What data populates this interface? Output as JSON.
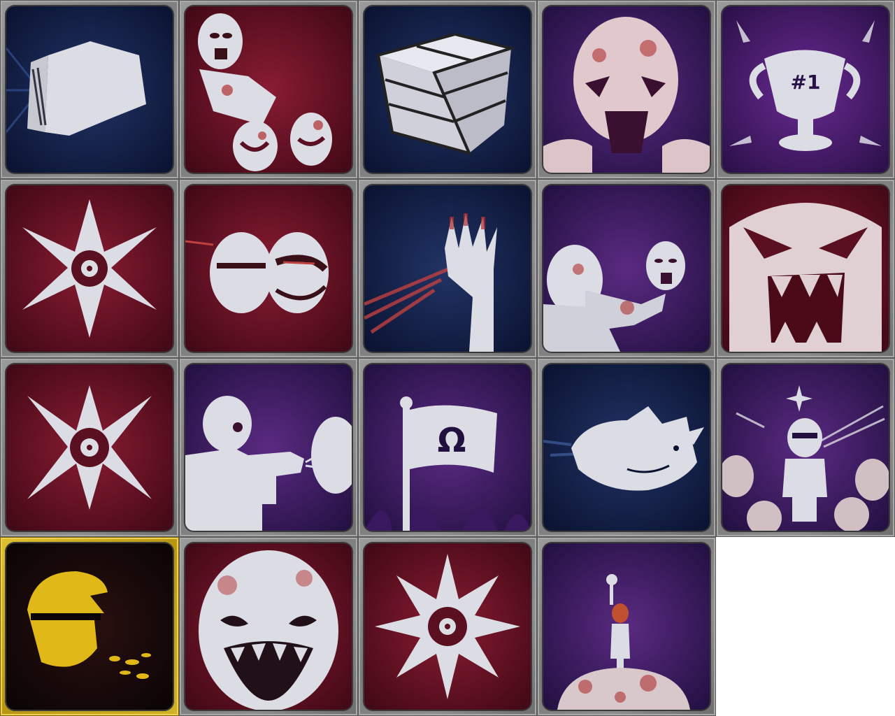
{
  "colors": {
    "frame": "#8a8a8a",
    "frame_gold": "#d4b020",
    "bg_blue": "#14204a",
    "bg_red": "#6a1024",
    "bg_purple": "#3c1858",
    "bg_black": "#120808",
    "figure": "#dcdce4",
    "blood": "#b03030",
    "gold_figure": "#e0b818"
  },
  "icons": [
    {
      "name": "punch-fist-icon",
      "bg": "blue"
    },
    {
      "name": "zombie-horde-icon",
      "bg": "red"
    },
    {
      "name": "brick-cube-icon",
      "bg": "blue"
    },
    {
      "name": "screaming-zombie-icon",
      "bg": "purple"
    },
    {
      "name": "trophy-number-one-icon",
      "bg": "purple",
      "label": "#1"
    },
    {
      "name": "throwing-star-icon",
      "bg": "red"
    },
    {
      "name": "headshot-heads-icon",
      "bg": "red"
    },
    {
      "name": "severed-hand-icon",
      "bg": "blue"
    },
    {
      "name": "zombie-punch-icon",
      "bg": "purple"
    },
    {
      "name": "angry-demon-face-icon",
      "bg": "red"
    },
    {
      "name": "throwing-star-alt-icon",
      "bg": "red"
    },
    {
      "name": "shooter-gun-icon",
      "bg": "purple"
    },
    {
      "name": "omega-flag-icon",
      "bg": "purple",
      "label": "Ω"
    },
    {
      "name": "flying-rhino-icon",
      "bg": "blue"
    },
    {
      "name": "hero-spotlight-icon",
      "bg": "purple"
    },
    {
      "name": "gold-vomit-head-icon",
      "bg": "black",
      "gold": true
    },
    {
      "name": "grinning-ghoul-icon",
      "bg": "red"
    },
    {
      "name": "eight-point-star-icon",
      "bg": "red"
    },
    {
      "name": "victory-pile-icon",
      "bg": "purple"
    }
  ]
}
